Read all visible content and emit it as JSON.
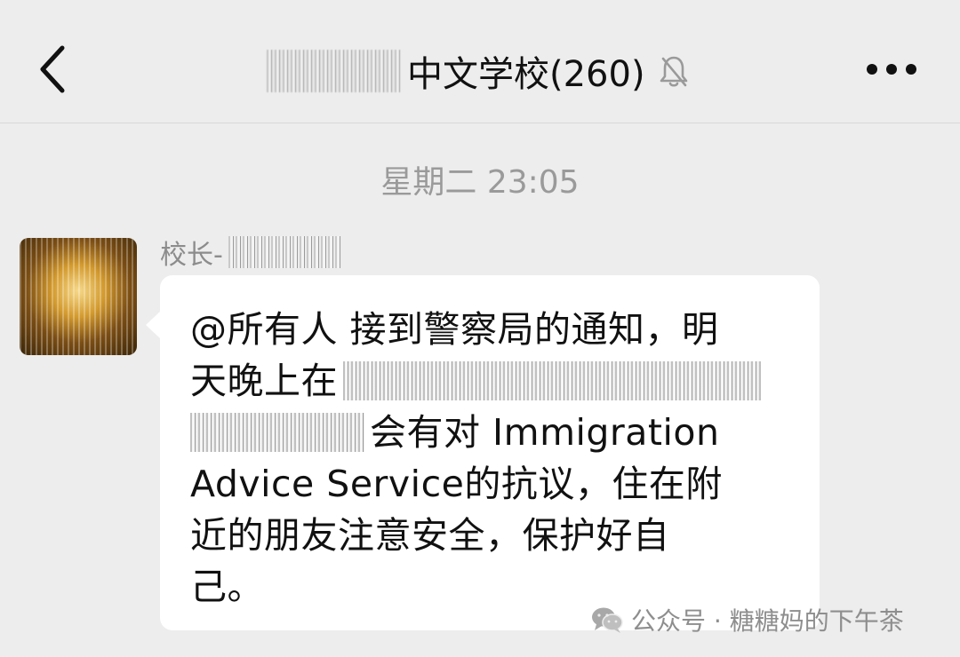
{
  "header": {
    "title": "中文学校(260)",
    "back_icon": "chevron-left-icon",
    "mute_icon": "bell-off-icon",
    "more_icon": "more-dots-icon"
  },
  "chat": {
    "timestamp": "星期二 23:05",
    "message": {
      "sender_prefix": "校长-",
      "lines": [
        "@所有人 接到警察局的通知，明",
        "天晚上在",
        "会有对 Immigration",
        "Advice Service的抗议，住在附",
        "近的朋友注意安全，保护好自",
        "己。"
      ]
    }
  },
  "watermark": {
    "text": "公众号 · 糖糖妈的下午茶",
    "icon": "wechat-icon"
  },
  "colors": {
    "background": "#ededed",
    "bubble": "#ffffff",
    "muted_text": "#9a9a9a"
  }
}
